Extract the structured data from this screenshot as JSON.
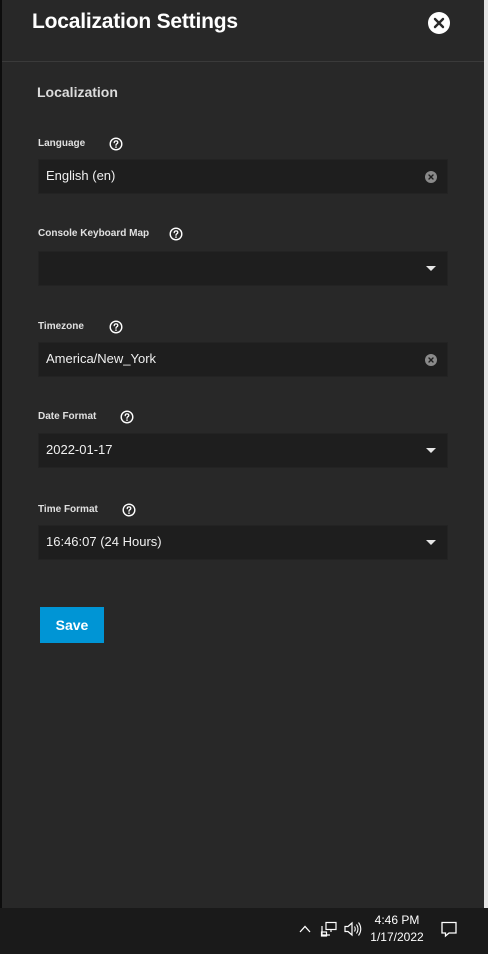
{
  "panel": {
    "title": "Localization Settings",
    "close_icon": "close-icon"
  },
  "section": {
    "title": "Localization"
  },
  "fields": {
    "language": {
      "label": "Language",
      "value": "English (en)",
      "control": "clearable-autocomplete"
    },
    "console_keyboard_map": {
      "label": "Console Keyboard Map",
      "value": "",
      "control": "select"
    },
    "timezone": {
      "label": "Timezone",
      "value": "America/New_York",
      "control": "clearable-autocomplete"
    },
    "date_format": {
      "label": "Date Format",
      "value": "2022-01-17",
      "control": "select"
    },
    "time_format": {
      "label": "Time Format",
      "value": "16:46:07 (24 Hours)",
      "control": "select"
    }
  },
  "actions": {
    "save_label": "Save"
  },
  "colors": {
    "panel_bg": "#282828",
    "field_bg": "#1e1e1e",
    "accent": "#0095d5",
    "text": "#ffffff"
  },
  "taskbar": {
    "time": "4:46 PM",
    "date": "1/17/2022",
    "tray_icons": [
      "chevron-up-icon",
      "network-icon",
      "volume-icon"
    ],
    "notification_icon": "notification-icon"
  }
}
